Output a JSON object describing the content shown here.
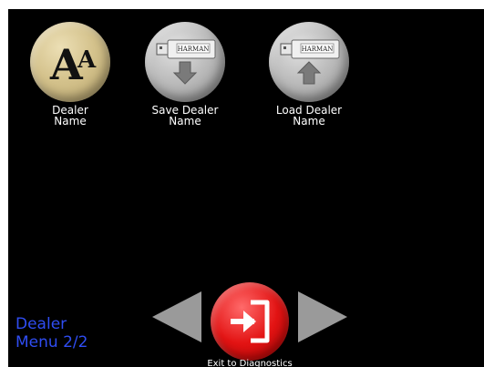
{
  "buttons": {
    "dealer_name": {
      "label": "Dealer\nName",
      "icon": "letters-aa-icon"
    },
    "save_dealer_name": {
      "label": "Save Dealer\nName",
      "icon": "usb-drive-download-icon",
      "brand": "HARMAN"
    },
    "load_dealer_name": {
      "label": "Load Dealer\nName",
      "icon": "usb-drive-upload-icon",
      "brand": "HARMAN"
    }
  },
  "page_title": {
    "line1": "Dealer",
    "line2": "Menu 2/2"
  },
  "exit": {
    "label": "Exit to Diagnostics"
  },
  "colors": {
    "background": "#000000",
    "page_title": "#2f4df2",
    "exit_button": "#e31414",
    "dealer_name_button": "#d4c28c",
    "usb_buttons": "#bdbdbd",
    "nav_arrows": "#9a9a9a"
  }
}
